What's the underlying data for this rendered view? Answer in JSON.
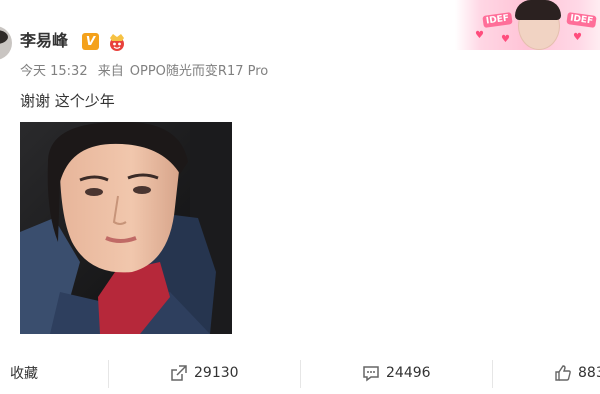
{
  "post": {
    "username": "李易峰",
    "verified_badge": "V",
    "time": "今天 15:32",
    "source_prefix": "来自",
    "source_device": "OPPO随光而变R17 Pro",
    "text": "谢谢 这个少年"
  },
  "banner": {
    "sticker_left": "IDEF",
    "sticker_right": "IDEF"
  },
  "actions": {
    "favorite_label": "收藏",
    "repost_count": "29130",
    "comment_count": "24496",
    "like_count": "883"
  },
  "colors": {
    "accent_orange": "#f4a11b",
    "text_main": "#333333",
    "text_meta": "#808080",
    "divider": "#e6e6e6",
    "banner_pink": "#ffc3d6"
  },
  "icons": {
    "repost": "repost-icon",
    "comment": "comment-icon",
    "like": "thumbs-up-icon",
    "verified": "verified-v-icon",
    "crown": "crown-badge-icon"
  }
}
